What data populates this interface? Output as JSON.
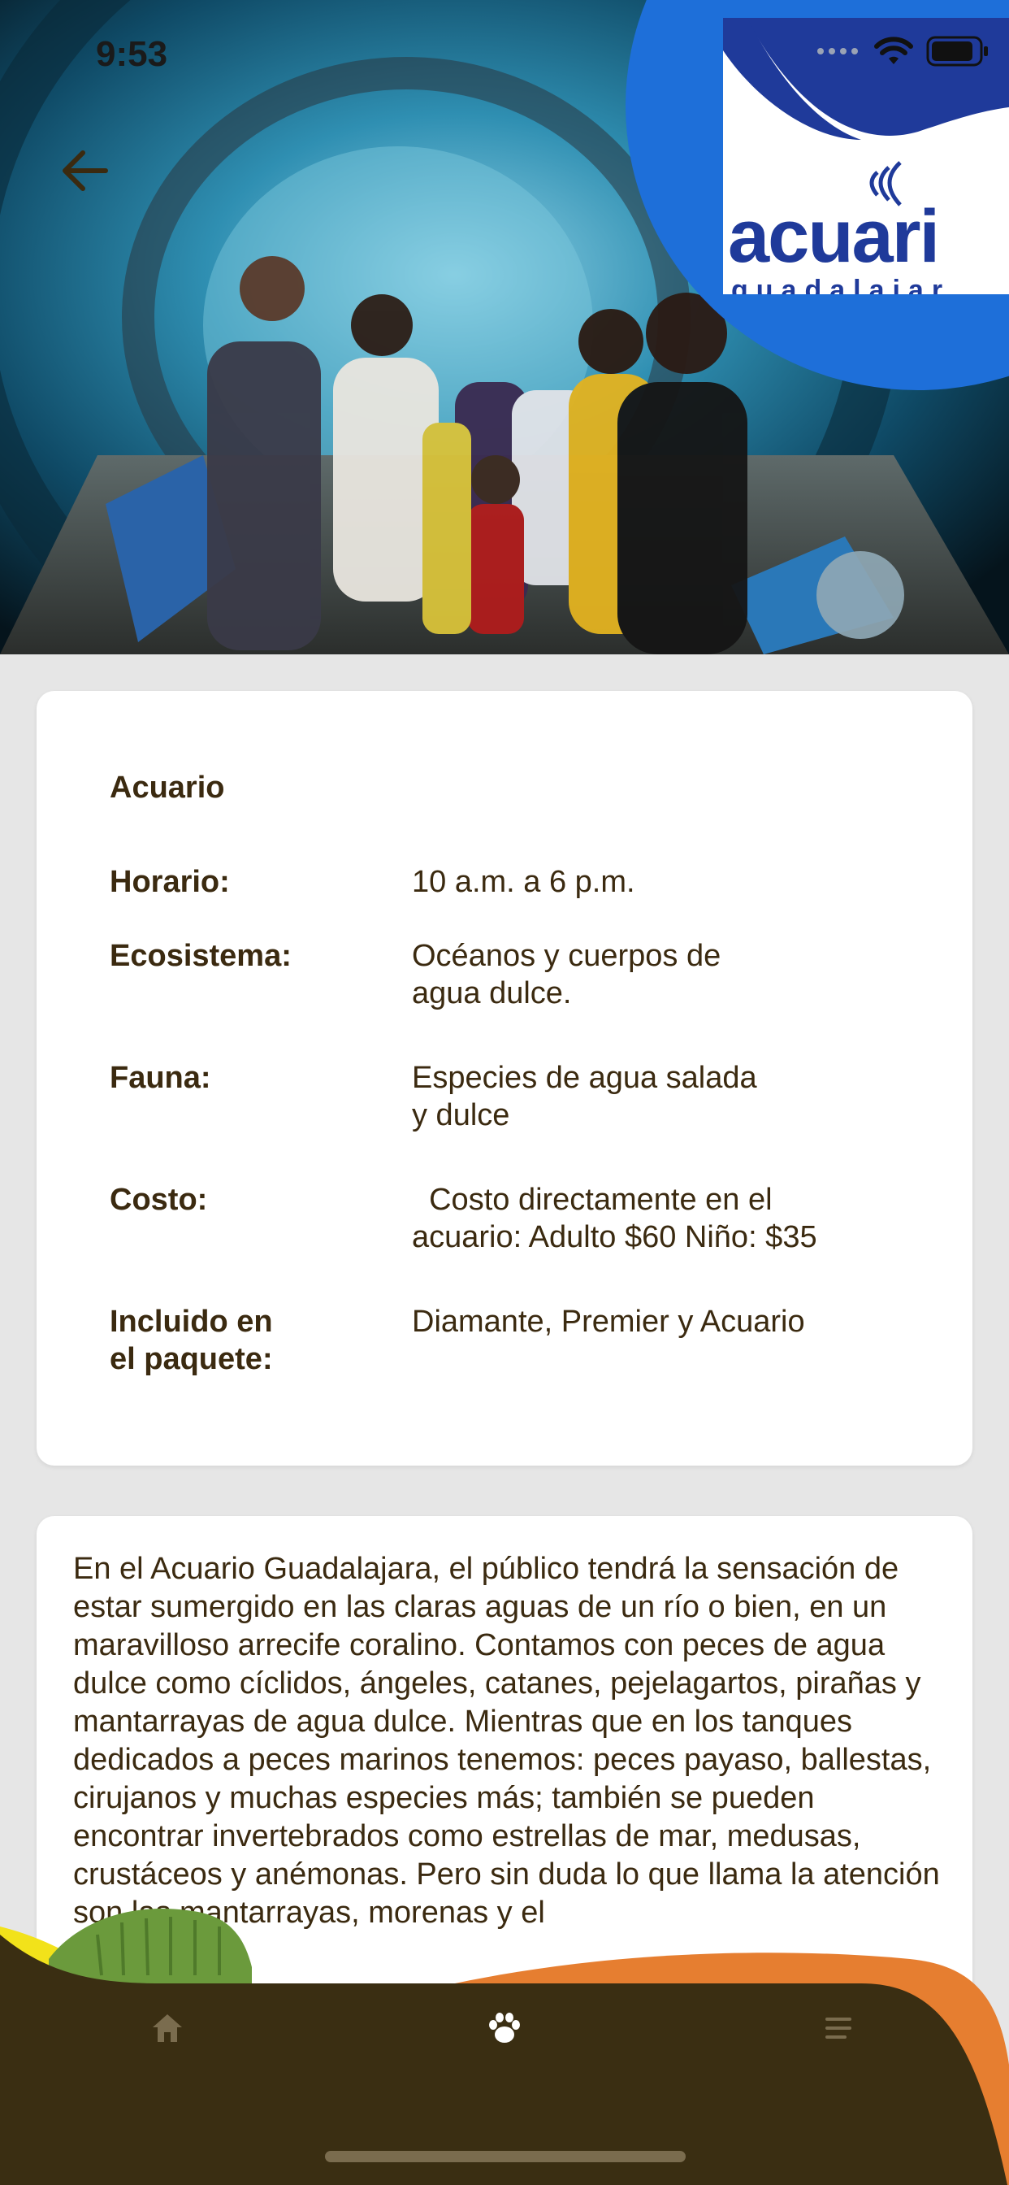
{
  "status_bar": {
    "time": "9:53"
  },
  "hero": {
    "logo_text": "acuari",
    "logo_subtext": "guadalajar"
  },
  "info": {
    "title": "Acuario",
    "rows": [
      {
        "label": "Horario:",
        "value": "10 a.m. a 6 p.m."
      },
      {
        "label": "Ecosistema:",
        "value": "Océanos y cuerpos de\nagua dulce."
      },
      {
        "label": "Fauna:",
        "value": "Especies de agua salada\ny dulce"
      },
      {
        "label": "Costo:",
        "value": "  Costo directamente en el\nacuario: Adulto $60 Niño: $35"
      },
      {
        "label": "Incluido en\nel paquete:",
        "value": "Diamante, Premier y Acuario"
      }
    ]
  },
  "description": {
    "text": "En el Acuario Guadalajara, el público tendrá la sensación de estar sumergido en las claras aguas de un río o bien, en un maravilloso arrecife coralino. Contamos con peces de agua dulce como cíclidos, ángeles, catanes, pejelagartos, pirañas y mantarrayas de agua dulce. Mientras que en los tanques dedicados a peces marinos tenemos: peces payaso, ballestas, cirujanos y muchas especies más; también se pueden encontrar invertebrados como estrellas de mar, medusas, crustáceos y anémonas. Pero sin duda lo que llama la atención son las mantarrayas, morenas y el"
  },
  "bottom_nav": {
    "items": [
      {
        "name": "home-icon"
      },
      {
        "name": "paw-icon"
      },
      {
        "name": "menu-icon"
      }
    ],
    "colors": {
      "bar": "#3a2e12",
      "accent_orange": "#e67e30",
      "accent_yellow": "#f2e21a",
      "accent_green": "#6b9a3c"
    }
  }
}
